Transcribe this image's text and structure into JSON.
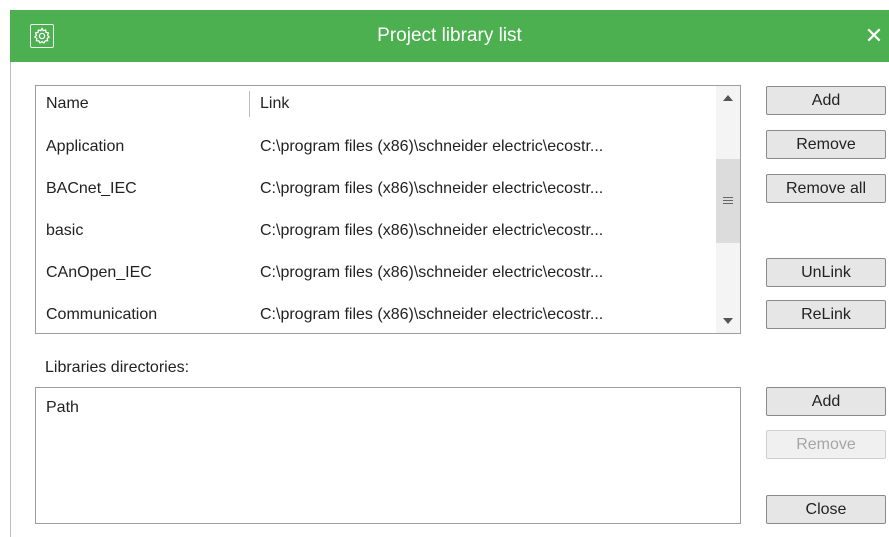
{
  "dialog": {
    "title": "Project library list",
    "close_glyph": "✕",
    "settings_icon": "gear-icon",
    "accent_color": "#4caf50"
  },
  "library_table": {
    "columns": [
      "Name",
      "Link"
    ],
    "rows": [
      {
        "name": "Application",
        "link": "C:\\program files (x86)\\schneider electric\\ecostr..."
      },
      {
        "name": "BACnet_IEC",
        "link": "C:\\program files (x86)\\schneider electric\\ecostr..."
      },
      {
        "name": "basic",
        "link": "C:\\program files (x86)\\schneider electric\\ecostr..."
      },
      {
        "name": "CAnOpen_IEC",
        "link": "C:\\program files (x86)\\schneider electric\\ecostr..."
      },
      {
        "name": "Communication",
        "link": "C:\\program files (x86)\\schneider electric\\ecostr..."
      }
    ]
  },
  "library_buttons": {
    "add": "Add",
    "remove": "Remove",
    "remove_all": "Remove all",
    "unlink": "UnLink",
    "relink": "ReLink"
  },
  "directories": {
    "label": "Libraries directories:",
    "column": "Path"
  },
  "directory_buttons": {
    "add": "Add",
    "remove": "Remove",
    "remove_disabled": true
  },
  "footer": {
    "close": "Close"
  }
}
